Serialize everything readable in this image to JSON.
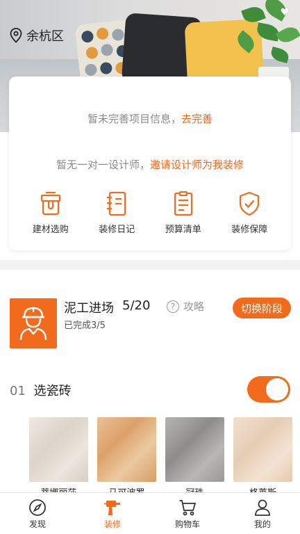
{
  "header": {
    "location": "余杭区",
    "location_icon": "map-pin-icon"
  },
  "info_card": {
    "project_prefix": "暂未完善项目信息，",
    "project_link": "去完善",
    "designer_prefix": "暂无一对一设计师，",
    "designer_link": "邀请设计师为我装修",
    "quick_actions": [
      {
        "label": "建材选购",
        "icon": "paint-bucket-icon"
      },
      {
        "label": "装修日记",
        "icon": "notebook-icon"
      },
      {
        "label": "预算清单",
        "icon": "checklist-icon"
      },
      {
        "label": "装修保障",
        "icon": "shield-check-icon"
      }
    ]
  },
  "stage": {
    "title": "泥工进场",
    "progress": "5/20",
    "guide_label": "攻略",
    "completed": "已完成3/5",
    "switch_label": "切换阶段",
    "icon": "worker-icon"
  },
  "step": {
    "number": "01",
    "name": "选瓷砖",
    "toggle_on": true,
    "products": [
      {
        "name": "蒂娜丽莎",
        "color": "#e5ddd3"
      },
      {
        "name": "马可波罗",
        "color": "#e3b688"
      },
      {
        "name": "冠珠",
        "color": "#a6a4a2"
      },
      {
        "name": "格莱斯",
        "color": "#ecd7c2"
      }
    ]
  },
  "tabbar": {
    "items": [
      {
        "label": "发现",
        "icon": "compass-icon",
        "active": false
      },
      {
        "label": "装修",
        "icon": "drill-icon",
        "active": true
      },
      {
        "label": "购物车",
        "icon": "cart-icon",
        "active": false
      },
      {
        "label": "我的",
        "icon": "user-icon",
        "active": false
      }
    ],
    "accent": "#f26a1b"
  }
}
